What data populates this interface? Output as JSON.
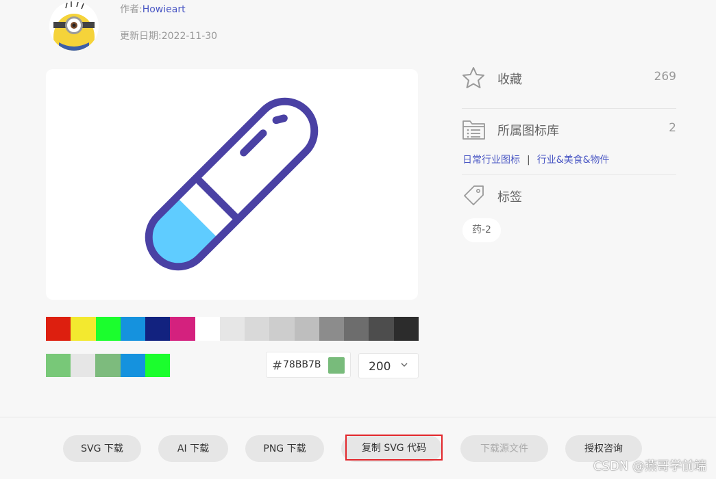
{
  "header": {
    "author_label": "作者:",
    "author_name": "Howieart",
    "date_label": "更新日期:",
    "date_value": "2022-11-30"
  },
  "icon_preview": {
    "name": "pill-icon",
    "outline_color": "#4a41a4",
    "fill_color": "#5fccff"
  },
  "palette": {
    "row1": [
      "#dd1f0f",
      "#f3e92f",
      "#1bfe2d",
      "#1592de",
      "#12227f",
      "#d4217e",
      "#ffffff",
      "#e6e6e6",
      "#d9d9d9",
      "#cdcdcd",
      "#bebebe",
      "#8c8c8c",
      "#6d6d6d",
      "#4d4d4d",
      "#2c2c2c"
    ],
    "row2": [
      "#78c878",
      "#e6e6e6",
      "#7dbb7d",
      "#1592de",
      "#1bfe2d"
    ]
  },
  "color_input": {
    "hash": "#",
    "hex": "78BB7B",
    "swatch_color": "#78bb7b"
  },
  "size_select": {
    "value": "200"
  },
  "sidebar": {
    "favorite_label": "收藏",
    "favorite_count": "269",
    "library_label": "所属图标库",
    "library_count": "2",
    "library_links": [
      "日常行业图标",
      "行业&美食&物件"
    ],
    "library_separator": "|",
    "tags_label": "标签",
    "tags": [
      "药-2"
    ]
  },
  "actions": {
    "svg_download": "SVG 下载",
    "ai_download": "AI 下载",
    "png_download": "PNG 下载",
    "copy_svg": "复制 SVG 代码",
    "source_download": "下载源文件",
    "license": "授权咨询"
  },
  "watermark": "CSDN @燕哥学前端"
}
